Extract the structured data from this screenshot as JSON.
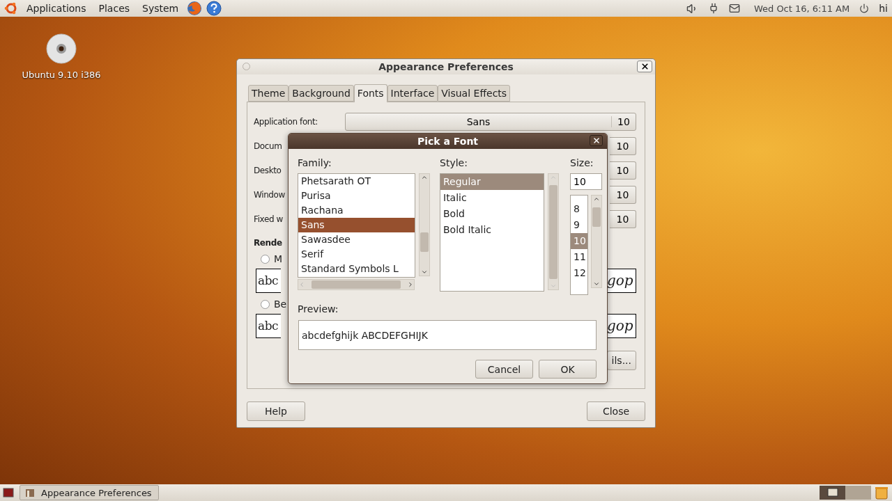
{
  "top_panel": {
    "menus": [
      "Applications",
      "Places",
      "System"
    ],
    "clock": "Wed Oct 16,  6:11 AM",
    "user": "hi"
  },
  "desktop_icons": [
    {
      "label": "Ubuntu 9.10 i386"
    }
  ],
  "appearance_window": {
    "title": "Appearance Preferences",
    "tabs": [
      {
        "label": "Theme",
        "selected": false
      },
      {
        "label": "Background",
        "selected": false
      },
      {
        "label": "Fonts",
        "selected": true
      },
      {
        "label": "Interface",
        "selected": false
      },
      {
        "label": "Visual Effects",
        "selected": false
      }
    ],
    "font_rows": [
      {
        "label": "Application font:",
        "font": "Sans",
        "size": "10"
      },
      {
        "label": "Docum",
        "size": "10"
      },
      {
        "label": "Deskto",
        "size": "10"
      },
      {
        "label": "Window",
        "size": "10"
      },
      {
        "label": "Fixed w",
        "size": "10"
      }
    ],
    "rendering_heading": "Rende",
    "rendering_options": [
      {
        "label": "M",
        "selected": false,
        "preview_left": "abc",
        "preview_right": "gop"
      },
      {
        "label": "Be",
        "selected": false,
        "preview_left": "abc",
        "preview_right": "gop"
      }
    ],
    "details_button": "ils...",
    "help_button": "Help",
    "close_button": "Close"
  },
  "font_dialog": {
    "title": "Pick a Font",
    "family_label": "Family:",
    "families": [
      {
        "name": "Phetsarath OT",
        "selected": false
      },
      {
        "name": "Purisa",
        "selected": false
      },
      {
        "name": "Rachana",
        "selected": false
      },
      {
        "name": "Sans",
        "selected": true
      },
      {
        "name": "Sawasdee",
        "selected": false
      },
      {
        "name": "Serif",
        "selected": false
      },
      {
        "name": "Standard Symbols L",
        "selected": false
      }
    ],
    "style_label": "Style:",
    "styles": [
      {
        "name": "Regular",
        "selected": true
      },
      {
        "name": "Italic",
        "selected": false
      },
      {
        "name": "Bold",
        "selected": false
      },
      {
        "name": "Bold Italic",
        "selected": false
      }
    ],
    "size_label": "Size:",
    "size_value": "10",
    "sizes": [
      {
        "value": "8",
        "selected": false
      },
      {
        "value": "9",
        "selected": false
      },
      {
        "value": "10",
        "selected": true
      },
      {
        "value": "11",
        "selected": false
      },
      {
        "value": "12",
        "selected": false
      }
    ],
    "preview_label": "Preview:",
    "preview_text": "abcdefghijk ABCDEFGHIJK",
    "cancel_button": "Cancel",
    "ok_button": "OK"
  },
  "taskbar": [
    {
      "label": "Appearance Preferences"
    }
  ]
}
